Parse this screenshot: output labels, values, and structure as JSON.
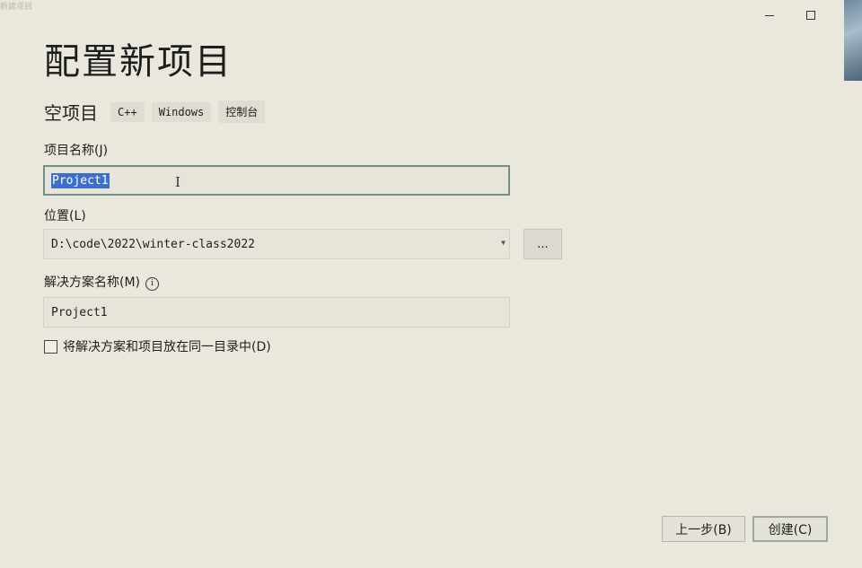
{
  "page": {
    "title": "配置新项目",
    "corner_mark": "新建项目"
  },
  "template": {
    "name": "空项目",
    "tags": [
      "C++",
      "Windows",
      "控制台"
    ]
  },
  "project_name": {
    "label": "项目名称(J)",
    "value": "Project1"
  },
  "location": {
    "label": "位置(L)",
    "value": "D:\\code\\2022\\winter-class2022",
    "browse_label": "..."
  },
  "solution_name": {
    "label": "解决方案名称(M)",
    "info_glyph": "i",
    "value": "Project1"
  },
  "same_dir": {
    "label": "将解决方案和项目放在同一目录中(D)",
    "checked": false
  },
  "footer": {
    "back_label": "上一步(B)",
    "create_label": "创建(C)"
  },
  "colors": {
    "background": "#eae8dd",
    "selection": "#3a6fd0",
    "focus_border": "#6f8e8c"
  }
}
